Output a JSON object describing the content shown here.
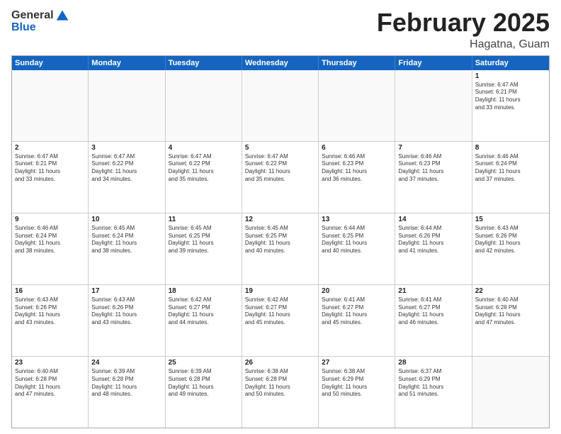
{
  "header": {
    "logo_general": "General",
    "logo_blue": "Blue",
    "title": "February 2025",
    "subtitle": "Hagatna, Guam"
  },
  "calendar": {
    "days": [
      "Sunday",
      "Monday",
      "Tuesday",
      "Wednesday",
      "Thursday",
      "Friday",
      "Saturday"
    ],
    "rows": [
      [
        {
          "day": "",
          "text": ""
        },
        {
          "day": "",
          "text": ""
        },
        {
          "day": "",
          "text": ""
        },
        {
          "day": "",
          "text": ""
        },
        {
          "day": "",
          "text": ""
        },
        {
          "day": "",
          "text": ""
        },
        {
          "day": "1",
          "text": "Sunrise: 6:47 AM\nSunset: 6:21 PM\nDaylight: 11 hours\nand 33 minutes."
        }
      ],
      [
        {
          "day": "2",
          "text": "Sunrise: 6:47 AM\nSunset: 6:21 PM\nDaylight: 11 hours\nand 33 minutes."
        },
        {
          "day": "3",
          "text": "Sunrise: 6:47 AM\nSunset: 6:22 PM\nDaylight: 11 hours\nand 34 minutes."
        },
        {
          "day": "4",
          "text": "Sunrise: 6:47 AM\nSunset: 6:22 PM\nDaylight: 11 hours\nand 35 minutes."
        },
        {
          "day": "5",
          "text": "Sunrise: 6:47 AM\nSunset: 6:22 PM\nDaylight: 11 hours\nand 35 minutes."
        },
        {
          "day": "6",
          "text": "Sunrise: 6:46 AM\nSunset: 6:23 PM\nDaylight: 11 hours\nand 36 minutes."
        },
        {
          "day": "7",
          "text": "Sunrise: 6:46 AM\nSunset: 6:23 PM\nDaylight: 11 hours\nand 37 minutes."
        },
        {
          "day": "8",
          "text": "Sunrise: 6:46 AM\nSunset: 6:24 PM\nDaylight: 11 hours\nand 37 minutes."
        }
      ],
      [
        {
          "day": "9",
          "text": "Sunrise: 6:46 AM\nSunset: 6:24 PM\nDaylight: 11 hours\nand 38 minutes."
        },
        {
          "day": "10",
          "text": "Sunrise: 6:45 AM\nSunset: 6:24 PM\nDaylight: 11 hours\nand 38 minutes."
        },
        {
          "day": "11",
          "text": "Sunrise: 6:45 AM\nSunset: 6:25 PM\nDaylight: 11 hours\nand 39 minutes."
        },
        {
          "day": "12",
          "text": "Sunrise: 6:45 AM\nSunset: 6:25 PM\nDaylight: 11 hours\nand 40 minutes."
        },
        {
          "day": "13",
          "text": "Sunrise: 6:44 AM\nSunset: 6:25 PM\nDaylight: 11 hours\nand 40 minutes."
        },
        {
          "day": "14",
          "text": "Sunrise: 6:44 AM\nSunset: 6:26 PM\nDaylight: 11 hours\nand 41 minutes."
        },
        {
          "day": "15",
          "text": "Sunrise: 6:43 AM\nSunset: 6:26 PM\nDaylight: 11 hours\nand 42 minutes."
        }
      ],
      [
        {
          "day": "16",
          "text": "Sunrise: 6:43 AM\nSunset: 6:26 PM\nDaylight: 11 hours\nand 43 minutes."
        },
        {
          "day": "17",
          "text": "Sunrise: 6:43 AM\nSunset: 6:26 PM\nDaylight: 11 hours\nand 43 minutes."
        },
        {
          "day": "18",
          "text": "Sunrise: 6:42 AM\nSunset: 6:27 PM\nDaylight: 11 hours\nand 44 minutes."
        },
        {
          "day": "19",
          "text": "Sunrise: 6:42 AM\nSunset: 6:27 PM\nDaylight: 11 hours\nand 45 minutes."
        },
        {
          "day": "20",
          "text": "Sunrise: 6:41 AM\nSunset: 6:27 PM\nDaylight: 11 hours\nand 45 minutes."
        },
        {
          "day": "21",
          "text": "Sunrise: 6:41 AM\nSunset: 6:27 PM\nDaylight: 11 hours\nand 46 minutes."
        },
        {
          "day": "22",
          "text": "Sunrise: 6:40 AM\nSunset: 6:28 PM\nDaylight: 11 hours\nand 47 minutes."
        }
      ],
      [
        {
          "day": "23",
          "text": "Sunrise: 6:40 AM\nSunset: 6:28 PM\nDaylight: 11 hours\nand 47 minutes."
        },
        {
          "day": "24",
          "text": "Sunrise: 6:39 AM\nSunset: 6:28 PM\nDaylight: 11 hours\nand 48 minutes."
        },
        {
          "day": "25",
          "text": "Sunrise: 6:39 AM\nSunset: 6:28 PM\nDaylight: 11 hours\nand 49 minutes."
        },
        {
          "day": "26",
          "text": "Sunrise: 6:38 AM\nSunset: 6:28 PM\nDaylight: 11 hours\nand 50 minutes."
        },
        {
          "day": "27",
          "text": "Sunrise: 6:38 AM\nSunset: 6:29 PM\nDaylight: 11 hours\nand 50 minutes."
        },
        {
          "day": "28",
          "text": "Sunrise: 6:37 AM\nSunset: 6:29 PM\nDaylight: 11 hours\nand 51 minutes."
        },
        {
          "day": "",
          "text": ""
        }
      ]
    ]
  }
}
